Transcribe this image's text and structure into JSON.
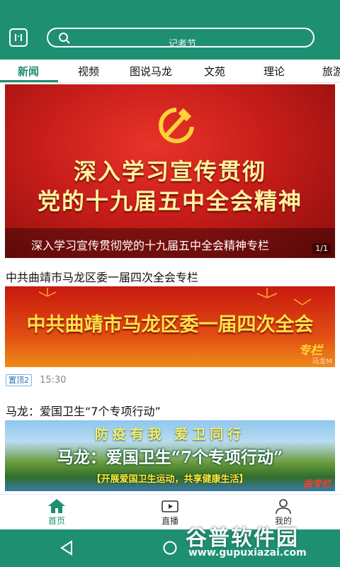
{
  "header": {
    "search_placeholder": "记者节",
    "colors": {
      "brand": "#1f8f72"
    }
  },
  "tabs": [
    {
      "label": "新闻",
      "active": true
    },
    {
      "label": "视频"
    },
    {
      "label": "图说马龙"
    },
    {
      "label": "文苑"
    },
    {
      "label": "理论"
    },
    {
      "label": "旅游"
    }
  ],
  "feed": {
    "banner1": {
      "line1": "深入学习宣传贯彻",
      "line2": "党的十九届五中全会精神",
      "caption": "深入学习宣传贯彻党的十九届五中全会精神专栏",
      "pager": "1/1"
    },
    "item1": {
      "title": "中共曲靖市马龙区委一届四次全会专栏",
      "banner_text": "中共曲靖市马龙区委一届四次全会",
      "banner_tag": "专栏",
      "banner_watermark": "马龙M",
      "badge": "置顶2",
      "time": "15:30"
    },
    "item2": {
      "title": "马龙：爱国卫生“7个专项行动”",
      "banner_top": "防疫有我 爱卫同行",
      "banner_main": "马龙：爱国卫生“7个专项行动”",
      "banner_sub": "【开展爱国卫生运动，共享健康生活】",
      "banner_tag": "曲专栏"
    }
  },
  "bottom_nav": [
    {
      "label": "首页",
      "icon": "home-icon",
      "active": true
    },
    {
      "label": "直播",
      "icon": "live-video-icon"
    },
    {
      "label": "我的",
      "icon": "user-icon"
    }
  ],
  "watermark": {
    "title": "谷普软件园",
    "url": "www.gupuxiazai.com"
  }
}
